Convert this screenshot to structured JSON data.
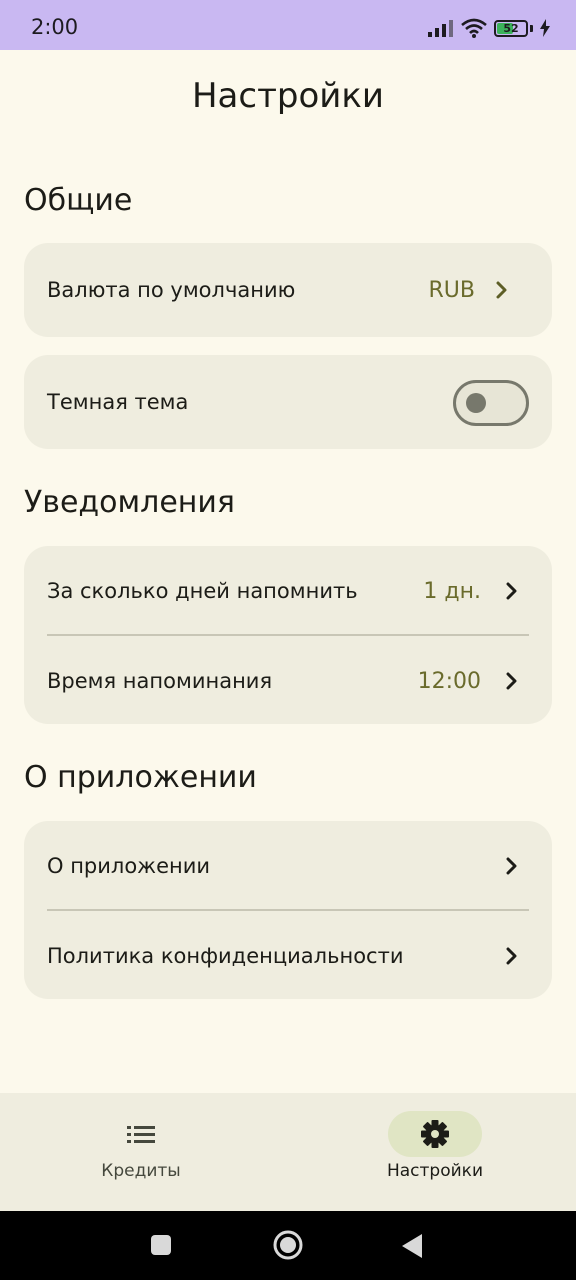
{
  "status_bar": {
    "time": "2:00",
    "battery_level": "52"
  },
  "page": {
    "title": "Настройки"
  },
  "sections": {
    "general": {
      "heading": "Общие",
      "currency_label": "Валюта по умолчанию",
      "currency_value": "RUB",
      "dark_theme_label": "Темная тема",
      "dark_theme_enabled": false
    },
    "notifications": {
      "heading": "Уведомления",
      "days_label": "За сколько дней напомнить",
      "days_value": "1 дн.",
      "time_label": "Время напоминания",
      "time_value": "12:00"
    },
    "about": {
      "heading": "О приложении",
      "about_label": "О приложении",
      "privacy_label": "Политика конфиденциальности"
    }
  },
  "bottom_nav": {
    "items": [
      {
        "label": "Кредиты",
        "icon": "list-icon",
        "active": false
      },
      {
        "label": "Настройки",
        "icon": "gear-icon",
        "active": true
      }
    ]
  },
  "colors": {
    "background": "#fcf9ec",
    "card": "#efeddf",
    "accent_value": "#6a6b2c",
    "status_bar": "#c9b8f2",
    "nav_active_pill": "#e0e5c4"
  }
}
